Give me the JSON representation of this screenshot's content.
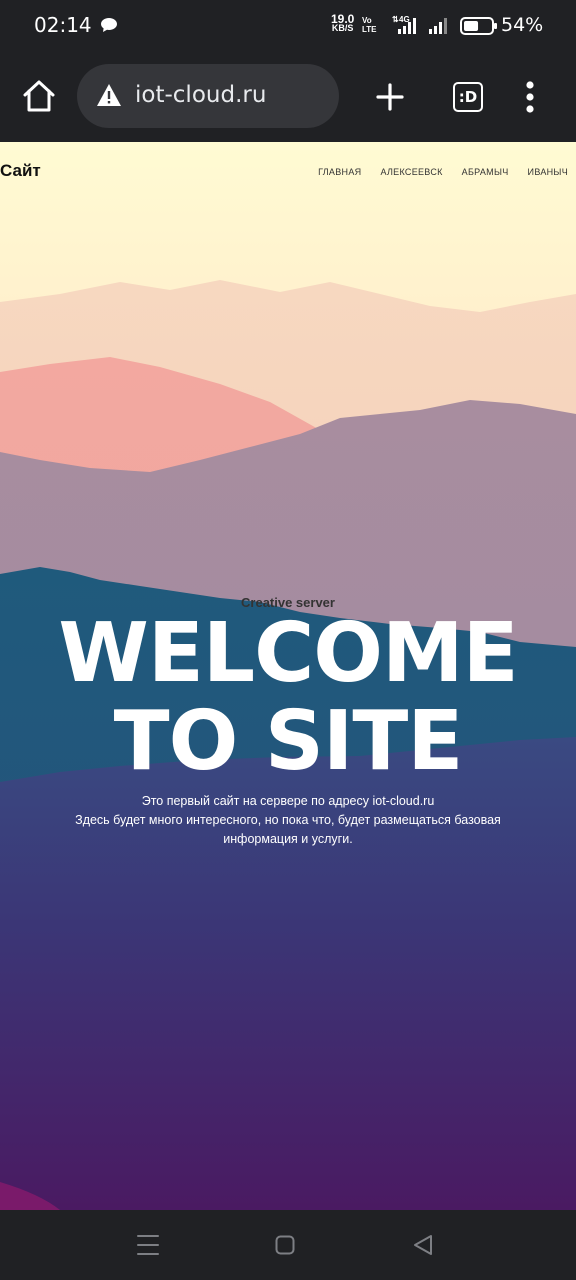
{
  "status_bar": {
    "time": "02:14",
    "net_speed_value": "19.0",
    "net_speed_unit": "KB/S",
    "volte_top": "Vo",
    "volte_bottom": "LTE",
    "network_type": "4G",
    "battery_percent": "54%",
    "battery_level": 0.54
  },
  "browser": {
    "url": "iot-cloud.ru",
    "tabs_label": ":D"
  },
  "site": {
    "logo": "Сайт",
    "nav": [
      "ГЛАВНАЯ",
      "АЛЕКСЕЕВСК",
      "АБРАМЫЧ",
      "ИВАНЫЧ"
    ],
    "hero_subtitle": "Creative server",
    "hero_title_line1": "WELCOME",
    "hero_title_line2": "TO SITE",
    "hero_desc_line1": "Это первый сайт на сервере по адресу iot-cloud.ru",
    "hero_desc_line2": "Здесь будет много интересного, но пока что, будет размещаться базовая",
    "hero_desc_line3": "информация и услуги."
  },
  "colors": {
    "chrome_bg": "#202124",
    "omnibox_bg": "#35363a",
    "sky_top": "#fffbd3",
    "mountain_teal": "#23577d",
    "mountain_purple": "#4b175e"
  },
  "icons": {
    "message": "message-bubble-icon",
    "home": "home-icon",
    "warning": "warning-triangle-icon",
    "new_tab": "plus-icon",
    "menu": "kebab-menu-icon",
    "nav_recents": "menu-lines-icon",
    "nav_home": "square-home-icon",
    "nav_back": "triangle-back-icon"
  }
}
